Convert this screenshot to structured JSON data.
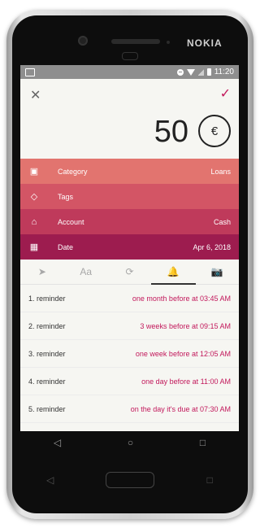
{
  "device": {
    "brand": "NOKIA"
  },
  "statusbar": {
    "time": "11:20"
  },
  "toolbar": {
    "close_icon": "close-icon",
    "confirm_icon": "check-icon"
  },
  "amount": {
    "value": "50",
    "currency": "€"
  },
  "rows": [
    {
      "label": "Category",
      "value": "Loans",
      "icon": "category-icon",
      "color": "#e2746f"
    },
    {
      "label": "Tags",
      "value": "",
      "icon": "tag-icon",
      "color": "#d35565"
    },
    {
      "label": "Account",
      "value": "Cash",
      "icon": "bank-icon",
      "color": "#bf3a5b"
    },
    {
      "label": "Date",
      "value": "Apr 6, 2018",
      "icon": "calendar-icon",
      "color": "#9d1c4f"
    }
  ],
  "tabs": [
    {
      "name": "location-icon",
      "glyph": "➤"
    },
    {
      "name": "text-icon",
      "glyph": "Aa"
    },
    {
      "name": "recurring-icon",
      "glyph": "⟳"
    },
    {
      "name": "bell-icon",
      "glyph": "🔔"
    },
    {
      "name": "camera-icon",
      "glyph": "📷"
    }
  ],
  "active_tab": "bell-icon",
  "reminders": [
    {
      "label": "1. reminder",
      "value": "one month before at 03:45 AM"
    },
    {
      "label": "2. reminder",
      "value": "3 weeks before at 09:15 AM"
    },
    {
      "label": "3. reminder",
      "value": "one week before at 12:05 AM"
    },
    {
      "label": "4. reminder",
      "value": "one day before at 11:00 AM"
    },
    {
      "label": "5. reminder",
      "value": "on the day it's due at 07:30 AM"
    }
  ],
  "colors": {
    "accent": "#c2185b"
  }
}
